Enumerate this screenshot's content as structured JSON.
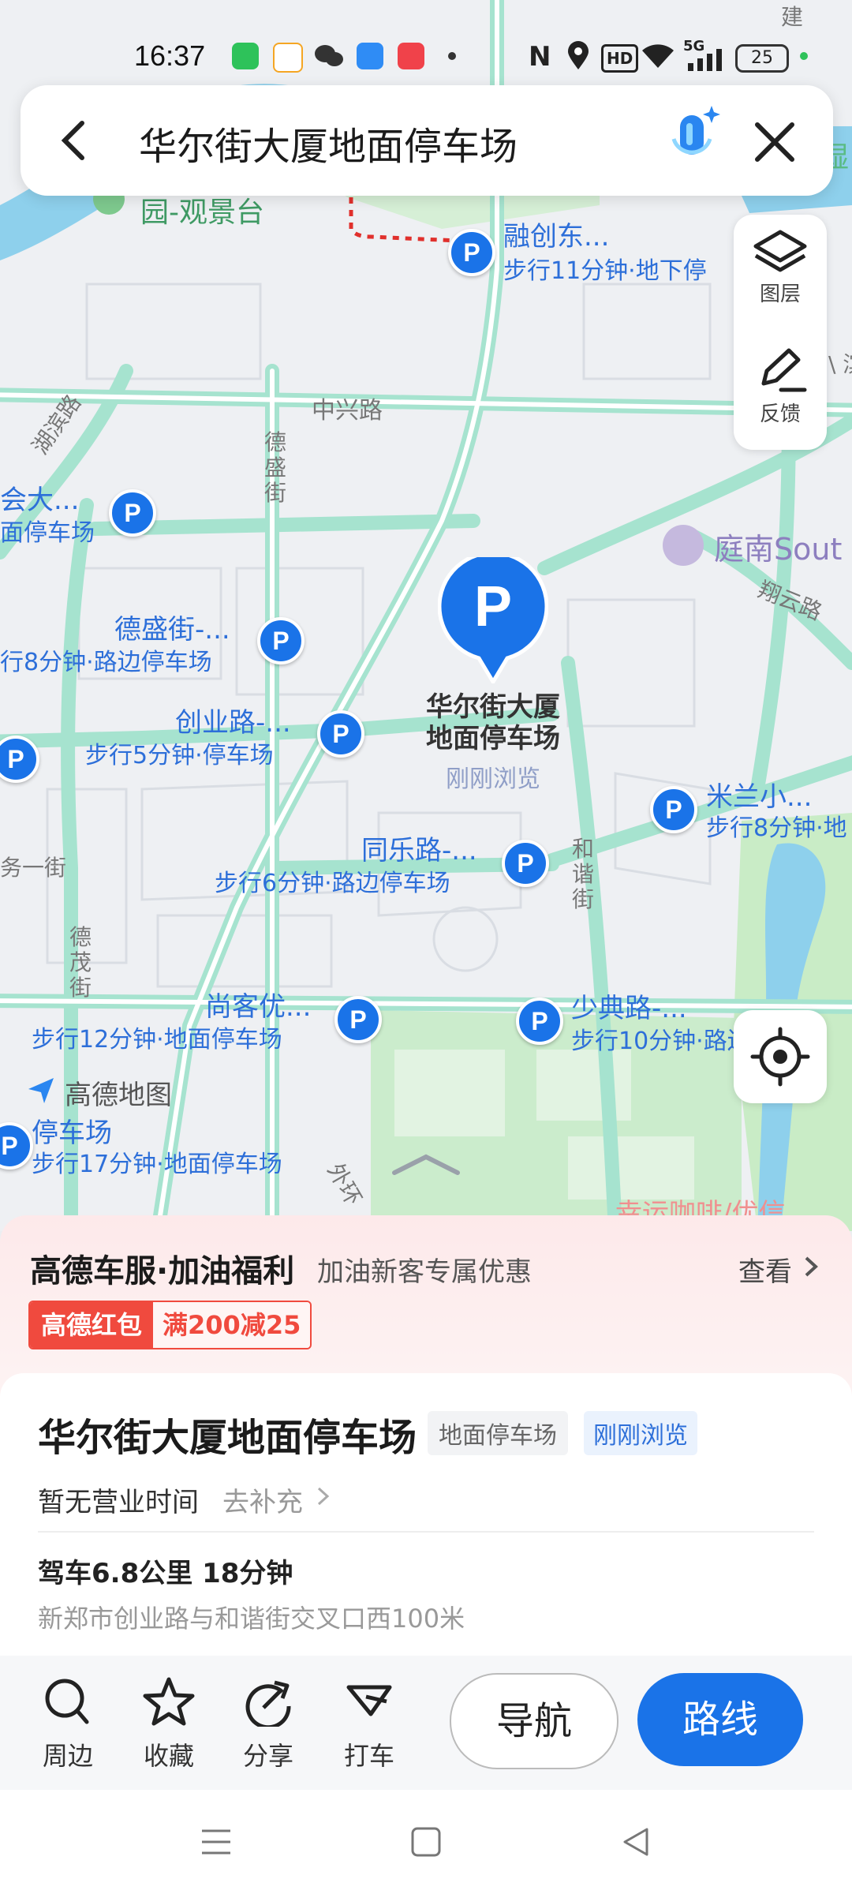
{
  "status_bar": {
    "time": "16:37",
    "network": "5G",
    "battery": "25",
    "hd_label": "HD",
    "nfc_label": "N"
  },
  "search": {
    "query": "华尔街大厦地面停车场"
  },
  "map": {
    "road_labels": {
      "zhongxing": "中兴路",
      "desheng": "德盛街",
      "huaibin": "湖滨路",
      "heixie": "和谐街",
      "xiangyun": "翔云路",
      "demao": "德茂街",
      "wuyi": "务一街",
      "outer": "外环",
      "jian": "建",
      "bin": "\\ 滨"
    },
    "park_label": "园-观景台",
    "hotel_label": "庭南Sout",
    "right_edge_label": "湿",
    "bottom_edge_label": "幸运咖啡/优信",
    "map_brand": "高德地图",
    "selected": {
      "pin_letter": "P",
      "name_line1": "华尔街大厦",
      "name_line2": "地面停车场",
      "tag": "刚刚浏览"
    },
    "parking_spots": [
      {
        "name": "融创东...",
        "detail": "步行11分钟·地下停"
      },
      {
        "name": "会大...",
        "detail": "面停车场"
      },
      {
        "name": "德盛街-...",
        "detail": "行8分钟·路边停车场"
      },
      {
        "name": "创业路-...",
        "detail": "步行5分钟·停车场"
      },
      {
        "name": "同乐路-...",
        "detail": "步行6分钟·路边停车场"
      },
      {
        "name": "米兰小...",
        "detail": "步行8分钟·地"
      },
      {
        "name": "尚客优...",
        "detail": "步行12分钟·地面停车场"
      },
      {
        "name": "少典路-...",
        "detail": "步行10分钟·路边停车场"
      },
      {
        "name": "停车场",
        "detail": "步行17分钟·地面停车场"
      }
    ]
  },
  "tools": {
    "layers": "图层",
    "feedback": "反馈"
  },
  "promo": {
    "title": "高德车服·加油福利",
    "subtitle": "加油新客专属优惠",
    "view": "查看",
    "badge": "高德红包",
    "offer": "满200减25"
  },
  "card": {
    "title": "华尔街大厦地面停车场",
    "tag_type": "地面停车场",
    "tag_recent": "刚刚浏览",
    "hours": "暂无营业时间",
    "supplement": "去补充",
    "drive": "驾车6.8公里 18分钟",
    "address": "新郑市创业路与和谐街交叉口西100米"
  },
  "actions": {
    "nearby": "周边",
    "favorite": "收藏",
    "share": "分享",
    "taxi": "打车",
    "navigate": "导航",
    "route": "路线"
  },
  "colors": {
    "accent": "#1a73e8",
    "road": "#a6e3cf",
    "water": "#8ed0ec",
    "green": "#c9ecc6",
    "promo_red": "#f04a3e"
  }
}
